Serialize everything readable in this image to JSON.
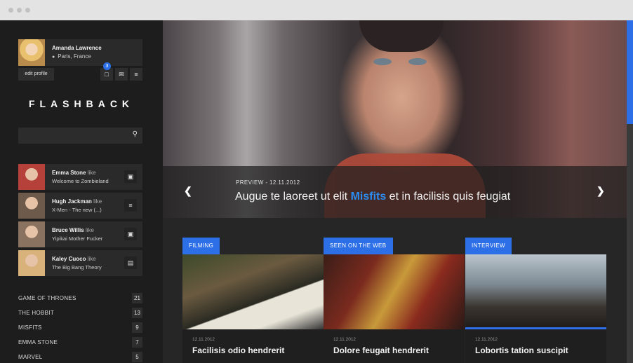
{
  "profile": {
    "name": "Amanda Lawrence",
    "location": "Paris, France",
    "edit_label": "edit profile",
    "notification_count": "3"
  },
  "logo": "FLASHBACK",
  "activity": [
    {
      "name": "Emma Stone",
      "verb": "like",
      "title": "Welcome to Zombieland",
      "icon": "film-icon",
      "color": "#b5413a"
    },
    {
      "name": "Hugh Jackman",
      "verb": "like",
      "title": "X-Men - The new (...)",
      "icon": "document-icon",
      "color": "#6d5a4a"
    },
    {
      "name": "Bruce Willis",
      "verb": "like",
      "title": "Yipikai Mother Fucker",
      "icon": "film-icon",
      "color": "#8a7260"
    },
    {
      "name": "Kaley Cuoco",
      "verb": "like",
      "title": "The Big Bang Theory",
      "icon": "clapper-icon",
      "color": "#d8b27a"
    }
  ],
  "tags": [
    {
      "name": "GAME OF THRONES",
      "count": "21"
    },
    {
      "name": "THE HOBBIT",
      "count": "13"
    },
    {
      "name": "MISFITS",
      "count": "9"
    },
    {
      "name": "EMMA STONE",
      "count": "7"
    },
    {
      "name": "MARVEL",
      "count": "5"
    }
  ],
  "hero": {
    "meta": "PREVIEW - 12.11.2012",
    "title_before": "Augue te laoreet ut elit ",
    "title_highlight": "Misfits",
    "title_after": " et in facilisis quis feugiat"
  },
  "cards": [
    {
      "label": "FILMING",
      "date": "12.11.2012",
      "title": "Facilisis odio hendrerit"
    },
    {
      "label": "SEEN ON THE WEB",
      "date": "12.11.2012",
      "title": "Dolore feugait hendrerit"
    },
    {
      "label": "INTERVIEW",
      "date": "12.11.2012",
      "title": "Lobortis tation suscipit"
    }
  ],
  "colors": {
    "accent": "#2c6fe6",
    "highlight": "#2c8cf0",
    "sidebar": "#1d1d1d"
  }
}
